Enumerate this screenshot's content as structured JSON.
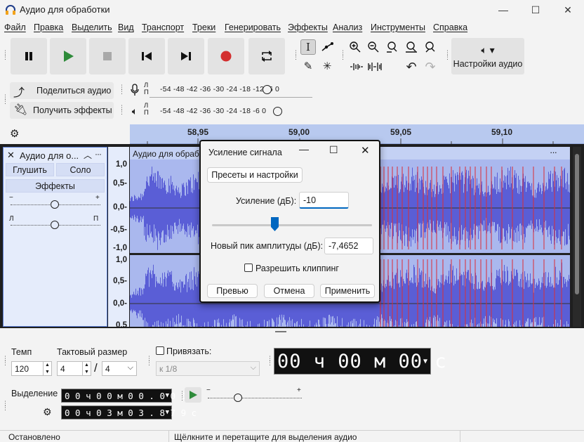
{
  "window": {
    "title": "Аудио для обработки",
    "controls": [
      "—",
      "☐",
      "✕"
    ]
  },
  "menu": [
    "Файл",
    "Правка",
    "Выделить",
    "Вид",
    "Транспорт",
    "Треки",
    "Генерировать",
    "Эффекты",
    "Анализ",
    "Инструменты",
    "Справка"
  ],
  "toolbar": {
    "audio_settings_label": "Настройки аудио",
    "share_audio_label": "Поделиться аудио",
    "get_effects_label": "Получить эффекты"
  },
  "meters": {
    "record_channels": "Л\nП",
    "play_channels": "Л\nП",
    "record_scale": "-54 -48 -42 -36 -30 -24 -18   -12 -6 0",
    "play_scale": "-54 -48 -42 -36 -30 -24 -18      -6 0"
  },
  "ruler": {
    "ticks": [
      "58,95",
      "59,00",
      "59,05",
      "59,10"
    ]
  },
  "track": {
    "name": "Аудио для о...",
    "clip_name": "Аудио для обраб",
    "mute_label": "Глушить",
    "solo_label": "Соло",
    "effects_label": "Эффекты",
    "gain_minus": "−",
    "gain_plus": "+",
    "pan_left": "Л",
    "pan_right": "П",
    "scale_top": [
      "1,0",
      "0,5-",
      "0,0-",
      "-0,5-",
      "-1,0"
    ],
    "scale_bottom": [
      "1,0",
      "0,5-",
      "0,0-",
      "0,5"
    ]
  },
  "dialog": {
    "title": "Усиление сигнала",
    "presets_label": "Пресеты и настройки",
    "gain_label": "Усиление (дБ):",
    "gain_value": "-10",
    "gain_slider_fraction": 0.39,
    "peak_label": "Новый пик амплитуды (дБ):",
    "peak_value": "-7,4652",
    "clipping_label": "Разрешить клиппинг",
    "preview_label": "Превью",
    "cancel_label": "Отмена",
    "apply_label": "Применить"
  },
  "bottom": {
    "tempo_label": "Темп",
    "tempo_value": "120",
    "timesig_label": "Тактовый размер",
    "timesig_num": "4",
    "timesig_den": "4",
    "snap_label": "Привязать:",
    "snap_value": "к 1/8",
    "big_time": "00 ч 00 м 00 с",
    "selection_label": "Выделение",
    "sel_start": "0 0 ч 0 0 м 0 0 . 0 0 0 с",
    "sel_end": "0 0 ч 0 3 м 0 3 . 8 7 9 с"
  },
  "status": {
    "left": "Остановлено",
    "right": "Щёлкните и перетащите для выделения аудио"
  },
  "colors": {
    "accent": "#0067c0",
    "wave": "#5a5ed6",
    "wave_bg": "#aab8ee",
    "ruler": "#b8c9ef",
    "record": "#d32f2f",
    "play": "#2e8b3a"
  }
}
